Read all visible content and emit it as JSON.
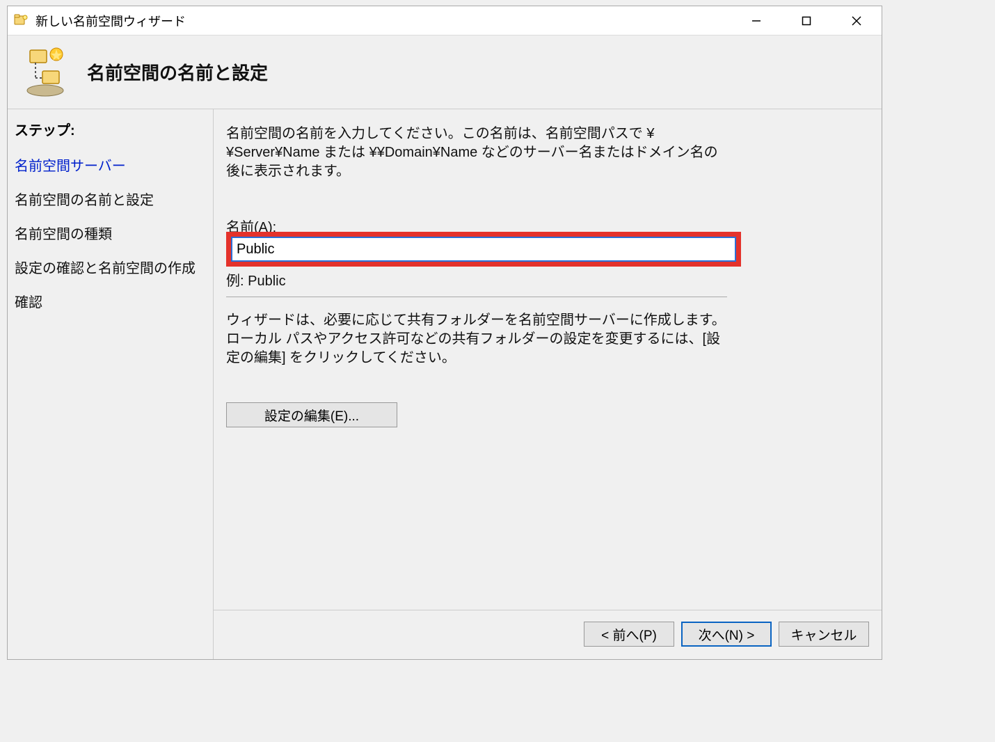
{
  "window": {
    "title": "新しい名前空間ウィザード"
  },
  "header": {
    "title": "名前空間の名前と設定"
  },
  "sidebar": {
    "steps_label": "ステップ:",
    "steps": [
      {
        "label": "名前空間サーバー",
        "link": true
      },
      {
        "label": "名前空間の名前と設定",
        "link": false
      },
      {
        "label": "名前空間の種類",
        "link": false
      },
      {
        "label": "設定の確認と名前空間の作成",
        "link": false
      },
      {
        "label": "確認",
        "link": false
      }
    ]
  },
  "main": {
    "intro": "名前空間の名前を入力してください。この名前は、名前空間パスで ¥¥Server¥Name または ¥¥Domain¥Name などのサーバー名またはドメイン名の後に表示されます。",
    "name_label": "名前(A):",
    "name_value": "Public",
    "example": "例: Public",
    "desc": "ウィザードは、必要に応じて共有フォルダーを名前空間サーバーに作成します。ローカル パスやアクセス許可などの共有フォルダーの設定を変更するには、[設定の編集] をクリックしてください。",
    "edit_button": "設定の編集(E)..."
  },
  "footer": {
    "back": "< 前へ(P)",
    "next": "次へ(N) >",
    "cancel": "キャンセル"
  }
}
